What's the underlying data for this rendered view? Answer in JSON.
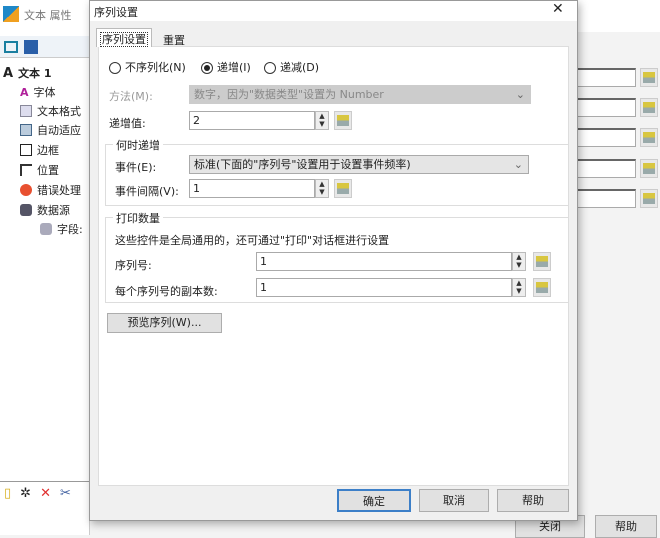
{
  "background": {
    "window_title": "文本 属性",
    "tree": [
      {
        "label": "文本 1",
        "icon": "text-icon"
      },
      {
        "label": "字体",
        "icon": "font-icon"
      },
      {
        "label": "文本格式",
        "icon": "text-format-icon"
      },
      {
        "label": "自动适应",
        "icon": "autofit-icon"
      },
      {
        "label": "边框",
        "icon": "border-icon"
      },
      {
        "label": "位置",
        "icon": "position-icon"
      },
      {
        "label": "错误处理",
        "icon": "error-icon"
      },
      {
        "label": "数据源",
        "icon": "datasource-icon"
      },
      {
        "label": "字段:",
        "icon": "database-icon"
      }
    ],
    "close_button": "关闭",
    "help_button": "帮助"
  },
  "dialog": {
    "title": "序列设置",
    "tabs": [
      {
        "label": "序列设置",
        "active": true
      },
      {
        "label": "重置",
        "active": false
      }
    ],
    "radios": [
      {
        "label": "不序列化(N)",
        "checked": false
      },
      {
        "label": "递增(I)",
        "checked": true
      },
      {
        "label": "递减(D)",
        "checked": false
      }
    ],
    "method_label": "方法(M):",
    "method_value": "数字，因为\"数据类型\"设置为 Number",
    "increment_label": "递增值:",
    "increment_value": "2",
    "when_group": "何时递增",
    "event_label": "事件(E):",
    "event_value": "标准(下面的\"序列号\"设置用于设置事件频率)",
    "interval_label": "事件间隔(V):",
    "interval_value": "1",
    "print_group": "打印数量",
    "print_note": "这些控件是全局通用的，还可通过\"打印\"对话框进行设置",
    "serial_label": "序列号:",
    "serial_value": "1",
    "copies_label": "每个序列号的副本数:",
    "copies_value": "1",
    "preview_button": "预览序列(W)...",
    "ok_button": "确定",
    "cancel_button": "取消",
    "help_button": "帮助"
  }
}
